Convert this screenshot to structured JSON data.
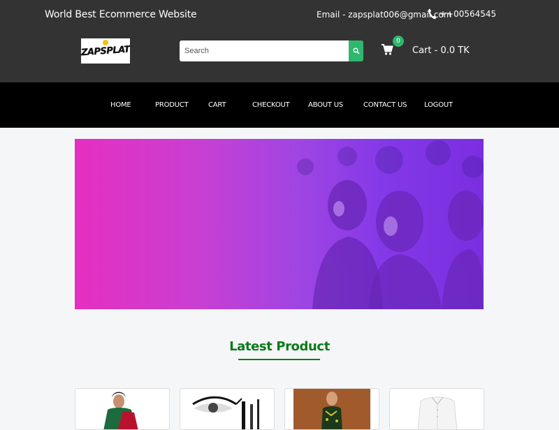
{
  "header": {
    "tagline": "World Best Ecommerce Website",
    "email": "Email - zapsplat006@gmail.com",
    "phone": "++00564545",
    "logo_text": "ZAPSPLAT",
    "search_placeholder": "Search",
    "cart_count": "0",
    "cart_label": "Cart -  0.0 TK"
  },
  "nav": {
    "items": [
      {
        "label": "HOME"
      },
      {
        "label": "PRODUCT"
      },
      {
        "label": "CART"
      },
      {
        "label": "CHECKOUT"
      },
      {
        "label": "ABOUT US"
      },
      {
        "label": "CONTACT US"
      },
      {
        "label": "LOGOUT"
      }
    ]
  },
  "section": {
    "title": "Latest Product"
  },
  "products": [
    {
      "image": "saree-model"
    },
    {
      "image": "eye-makeup"
    },
    {
      "image": "kurta-model"
    },
    {
      "image": "white-shirt"
    }
  ],
  "colors": {
    "topbar": "#333333",
    "nav": "#000000",
    "accent": "#2eb86d",
    "title": "#0c7a1a"
  }
}
